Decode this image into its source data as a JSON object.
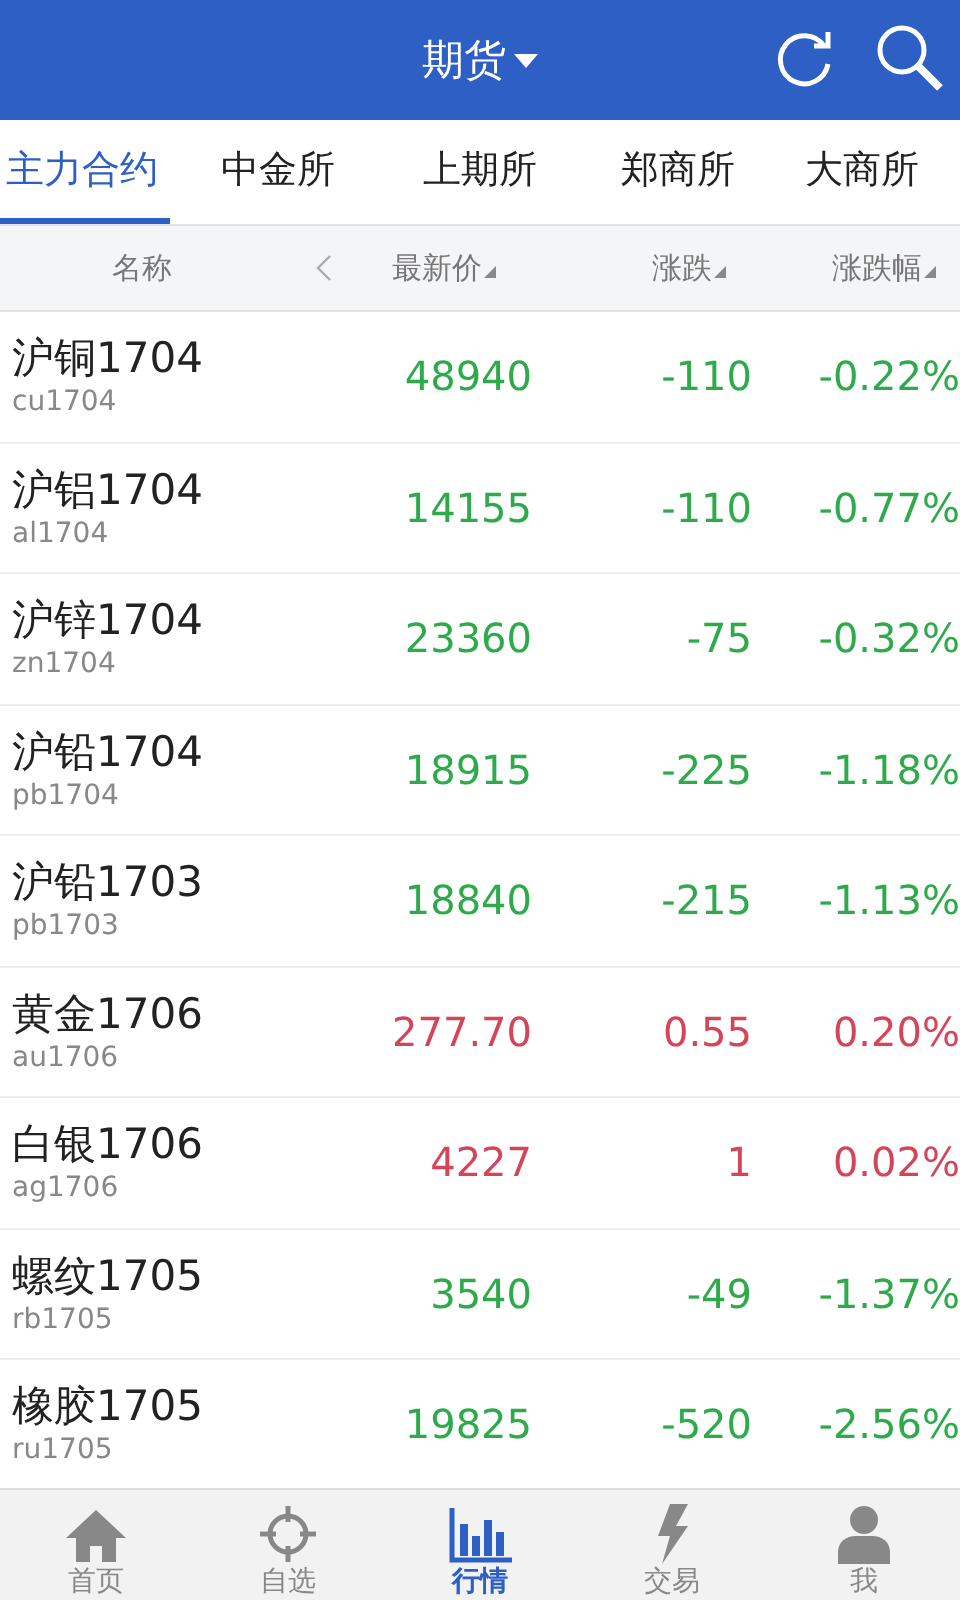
{
  "header": {
    "title": "期货"
  },
  "tabs": [
    {
      "label": "主力合约",
      "selected": true
    },
    {
      "label": "中金所",
      "selected": false
    },
    {
      "label": "上期所",
      "selected": false
    },
    {
      "label": "郑商所",
      "selected": false
    },
    {
      "label": "大商所",
      "selected": false
    }
  ],
  "table": {
    "columns": [
      "名称",
      "最新价",
      "涨跌",
      "涨跌幅"
    ],
    "rows": [
      {
        "name": "沪铜1704",
        "code": "cu1704",
        "price": "48940",
        "change": "-110",
        "percent": "-0.22%",
        "color": "#2eaa4a"
      },
      {
        "name": "沪铝1704",
        "code": "al1704",
        "price": "14155",
        "change": "-110",
        "percent": "-0.77%",
        "color": "#2eaa4a"
      },
      {
        "name": "沪锌1704",
        "code": "zn1704",
        "price": "23360",
        "change": "-75",
        "percent": "-0.32%",
        "color": "#2eaa4a"
      },
      {
        "name": "沪铅1704",
        "code": "pb1704",
        "price": "18915",
        "change": "-225",
        "percent": "-1.18%",
        "color": "#2eaa4a"
      },
      {
        "name": "沪铅1703",
        "code": "pb1703",
        "price": "18840",
        "change": "-215",
        "percent": "-1.13%",
        "color": "#2eaa4a"
      },
      {
        "name": "黄金1706",
        "code": "au1706",
        "price": "277.70",
        "change": "0.55",
        "percent": "0.20%",
        "color": "#d4455a"
      },
      {
        "name": "白银1706",
        "code": "ag1706",
        "price": "4227",
        "change": "1",
        "percent": "0.02%",
        "color": "#d4455a"
      },
      {
        "name": "螺纹1705",
        "code": "rb1705",
        "price": "3540",
        "change": "-49",
        "percent": "-1.37%",
        "color": "#2eaa4a"
      },
      {
        "name": "橡胶1705",
        "code": "ru1705",
        "price": "19825",
        "change": "-520",
        "percent": "-2.56%",
        "color": "#2eaa4a"
      }
    ]
  },
  "nav": [
    {
      "label": "首页",
      "kind": "home",
      "selected": false
    },
    {
      "label": "自选",
      "kind": "target",
      "selected": false
    },
    {
      "label": "行情",
      "kind": "chart",
      "selected": true
    },
    {
      "label": "交易",
      "kind": "bolt",
      "selected": false
    },
    {
      "label": "我",
      "kind": "person",
      "selected": false
    }
  ]
}
